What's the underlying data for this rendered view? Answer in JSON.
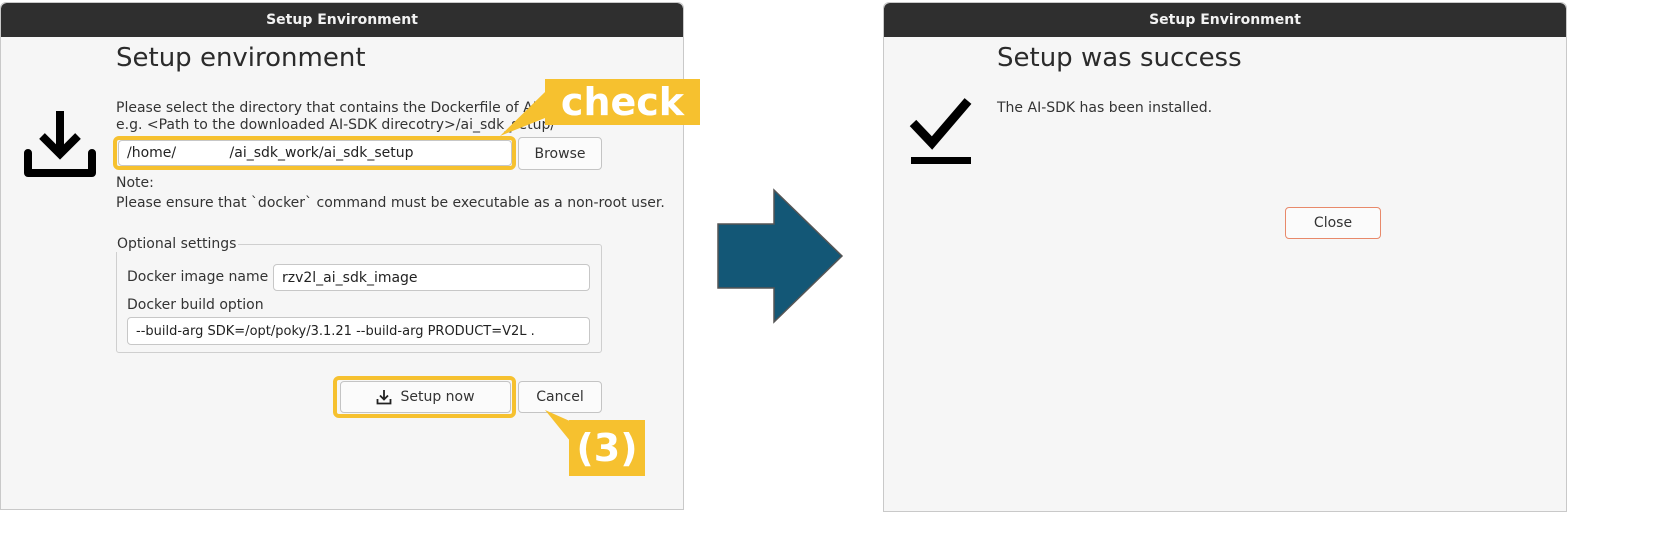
{
  "left_window": {
    "title": "Setup Environment",
    "heading": "Setup environment",
    "instruction_line1": "Please select the directory that contains the Dockerfile of AI-SDK.",
    "instruction_line2": "e.g. <Path to the downloaded AI-SDK direcotry>/ai_sdk_setup/",
    "directory_value": "/home/            /ai_sdk_work/ai_sdk_setup",
    "browse_label": "Browse",
    "note_title": "Note:",
    "note_text": "Please ensure that `docker` command must be executable as a non-root user.",
    "optional_legend": "Optional settings",
    "image_name_label": "Docker image name",
    "image_name_value": "rzv2l_ai_sdk_image",
    "build_option_label": "Docker build option",
    "build_option_value": "--build-arg SDK=/opt/poky/3.1.21 --build-arg PRODUCT=V2L .",
    "setup_now_label": "Setup now",
    "cancel_label": "Cancel"
  },
  "annotations": {
    "check_label": "check",
    "step_label": "(3)",
    "highlight_color": "#f6c12f"
  },
  "arrow_color": "#135776",
  "right_window": {
    "title": "Setup Environment",
    "heading": "Setup was success",
    "message": "The AI-SDK has been installed.",
    "close_label": "Close"
  },
  "icons": {
    "left": "download-icon",
    "right": "checkmark-icon",
    "setup_button": "download-icon"
  }
}
